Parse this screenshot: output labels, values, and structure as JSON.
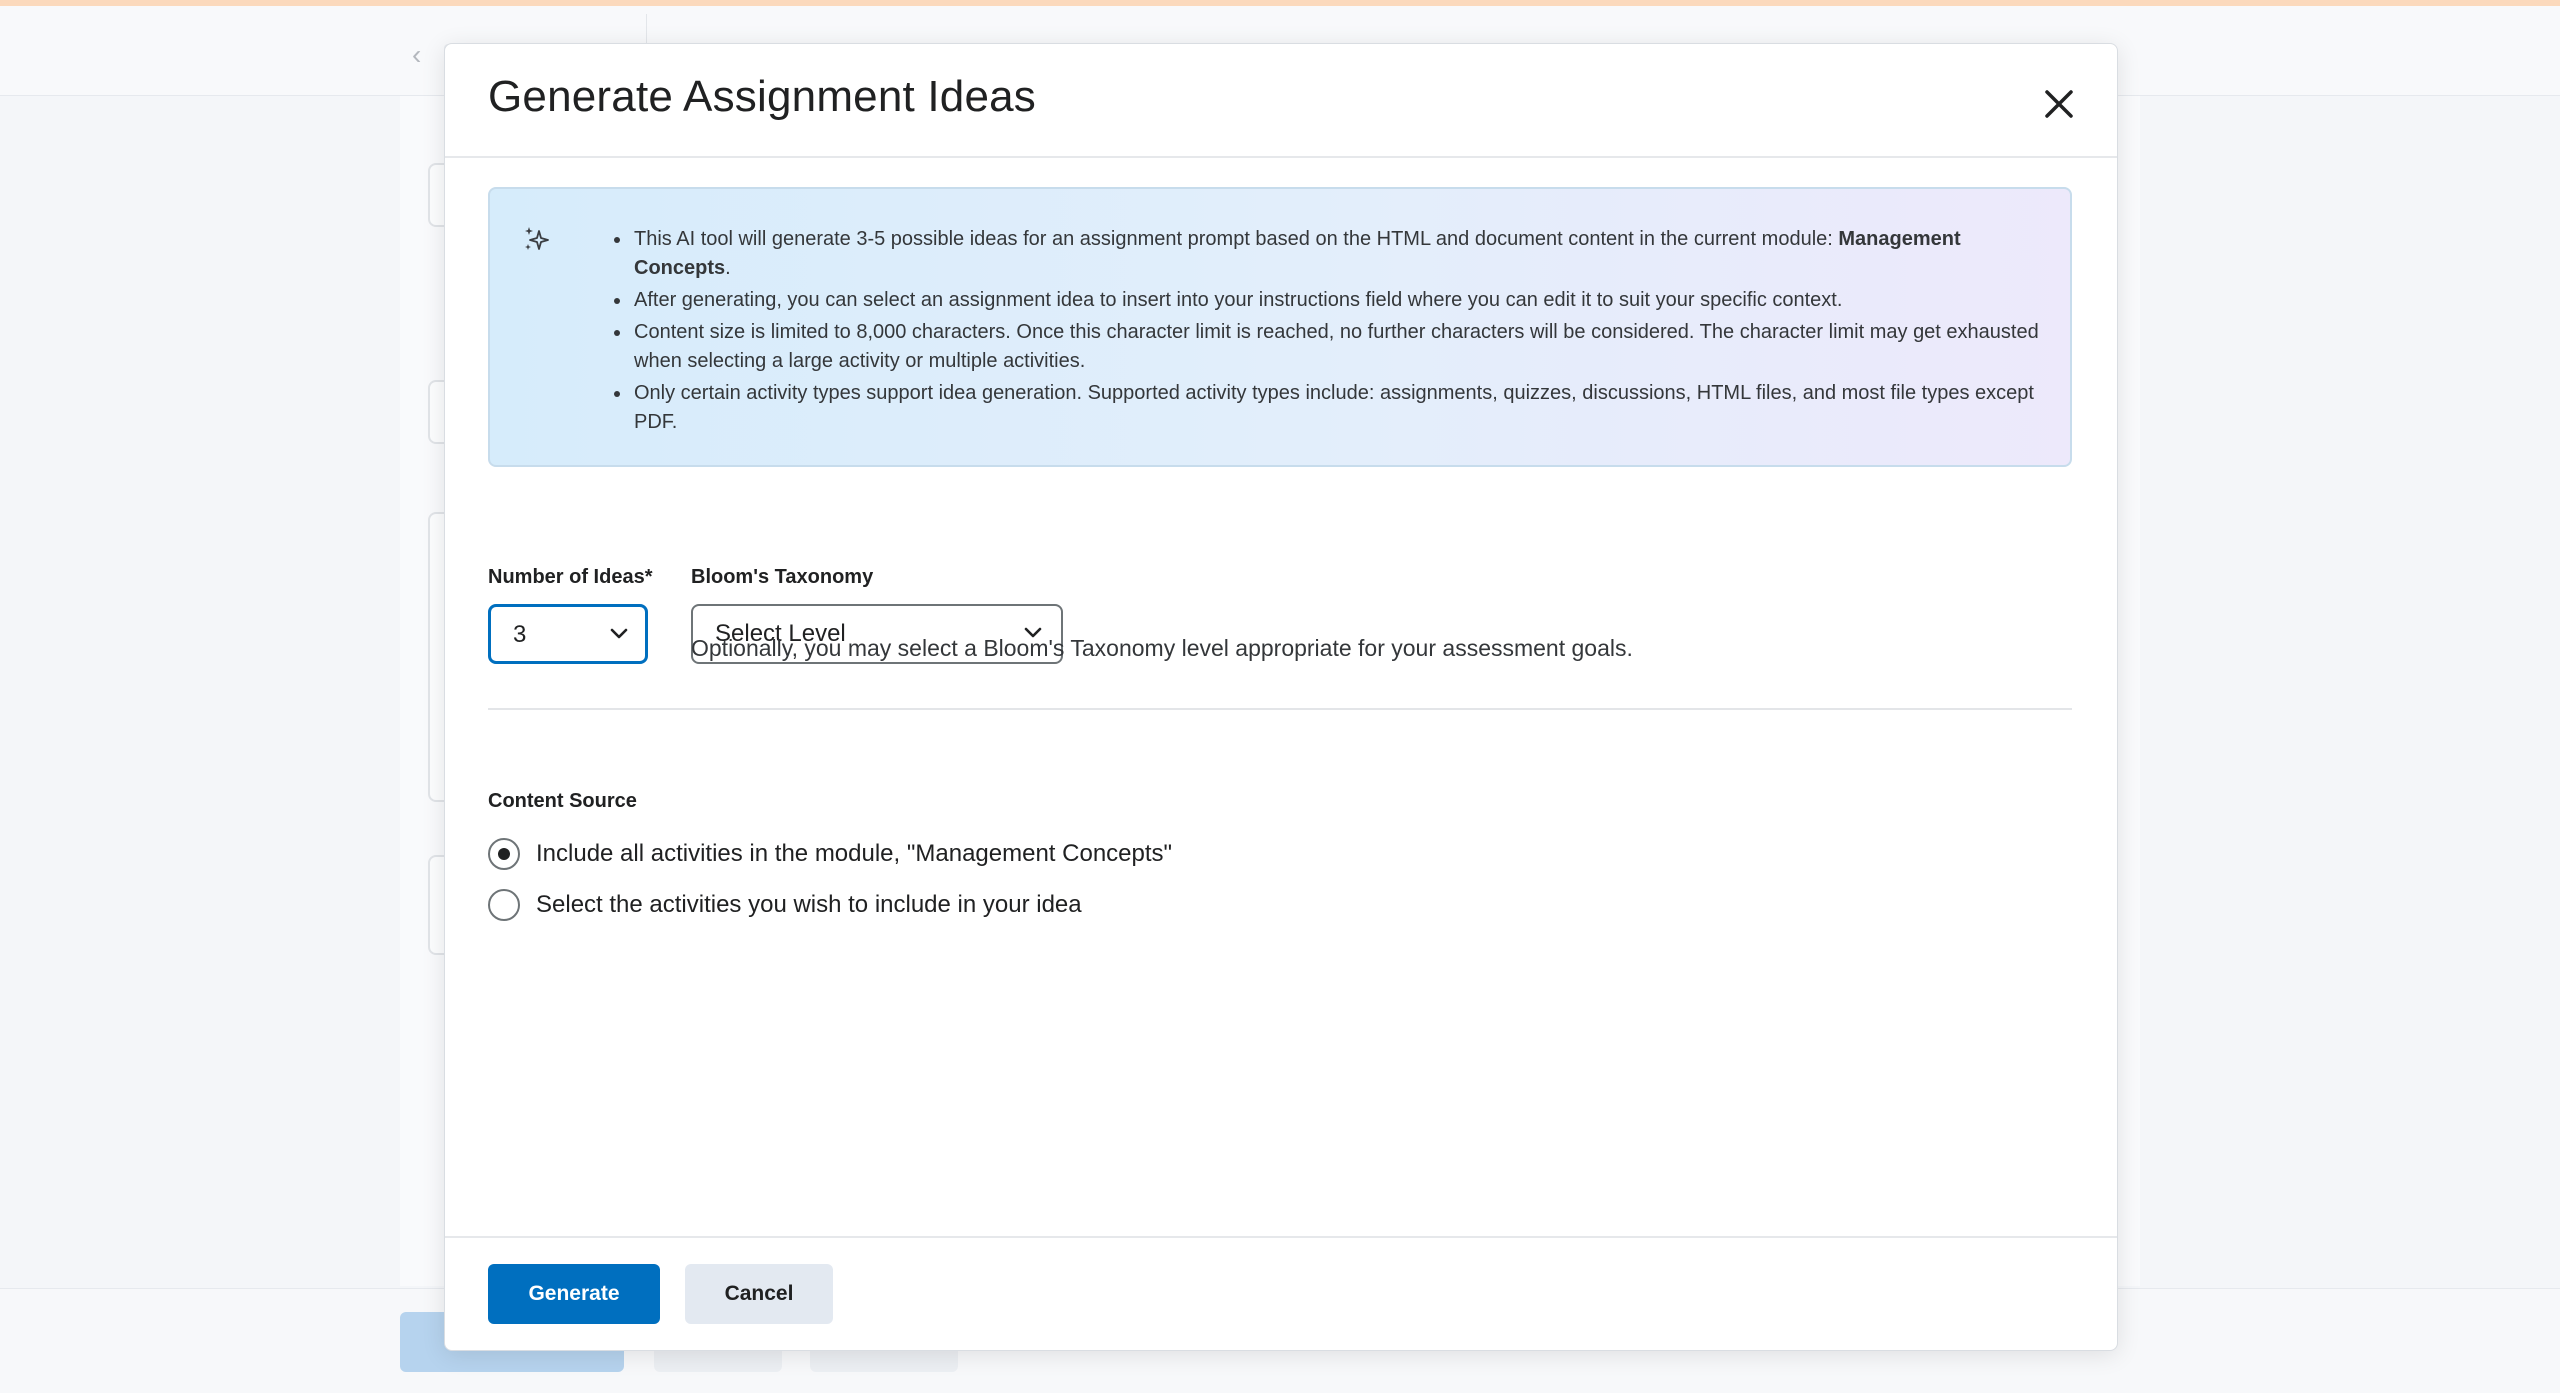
{
  "dialog": {
    "title": "Generate Assignment Ideas",
    "close_icon": "close-icon",
    "info": {
      "icon": "sparkle-icon",
      "bullet1_text": "This AI tool will generate 3-5 possible ideas for an assignment prompt based on the HTML and document content in the current module: ",
      "bullet1_module": "Management Concepts",
      "bullet1_end": ".",
      "bullet2": "After generating, you can select an assignment idea to insert into your instructions field where you can edit it to suit your specific context.",
      "bullet3": "Content size is limited to 8,000 characters. Once this character limit is reached, no further characters will be considered. The character limit may get exhausted when selecting a large activity or multiple activities.",
      "bullet4": "Only certain activity types support idea generation. Supported activity types include: assignments, quizzes, discussions, HTML files, and most file types except PDF."
    },
    "number_of_ideas": {
      "label": "Number of Ideas*",
      "value": "3"
    },
    "blooms": {
      "label": "Bloom's Taxonomy",
      "value": "Select Level",
      "hint": "Optionally, you may select a Bloom's Taxonomy level appropriate for your assessment goals."
    },
    "content_source": {
      "label": "Content Source",
      "options": [
        {
          "label": "Include all activities in the module, \"Management Concepts\"",
          "checked": true
        },
        {
          "label": "Select the activities you wish to include in your idea",
          "checked": false
        }
      ]
    },
    "buttons": {
      "generate": "Generate",
      "cancel": "Cancel"
    }
  },
  "colors": {
    "primary": "#006fbf",
    "focus_border": "#006fbf",
    "top_accent": "#fbd9bc"
  }
}
